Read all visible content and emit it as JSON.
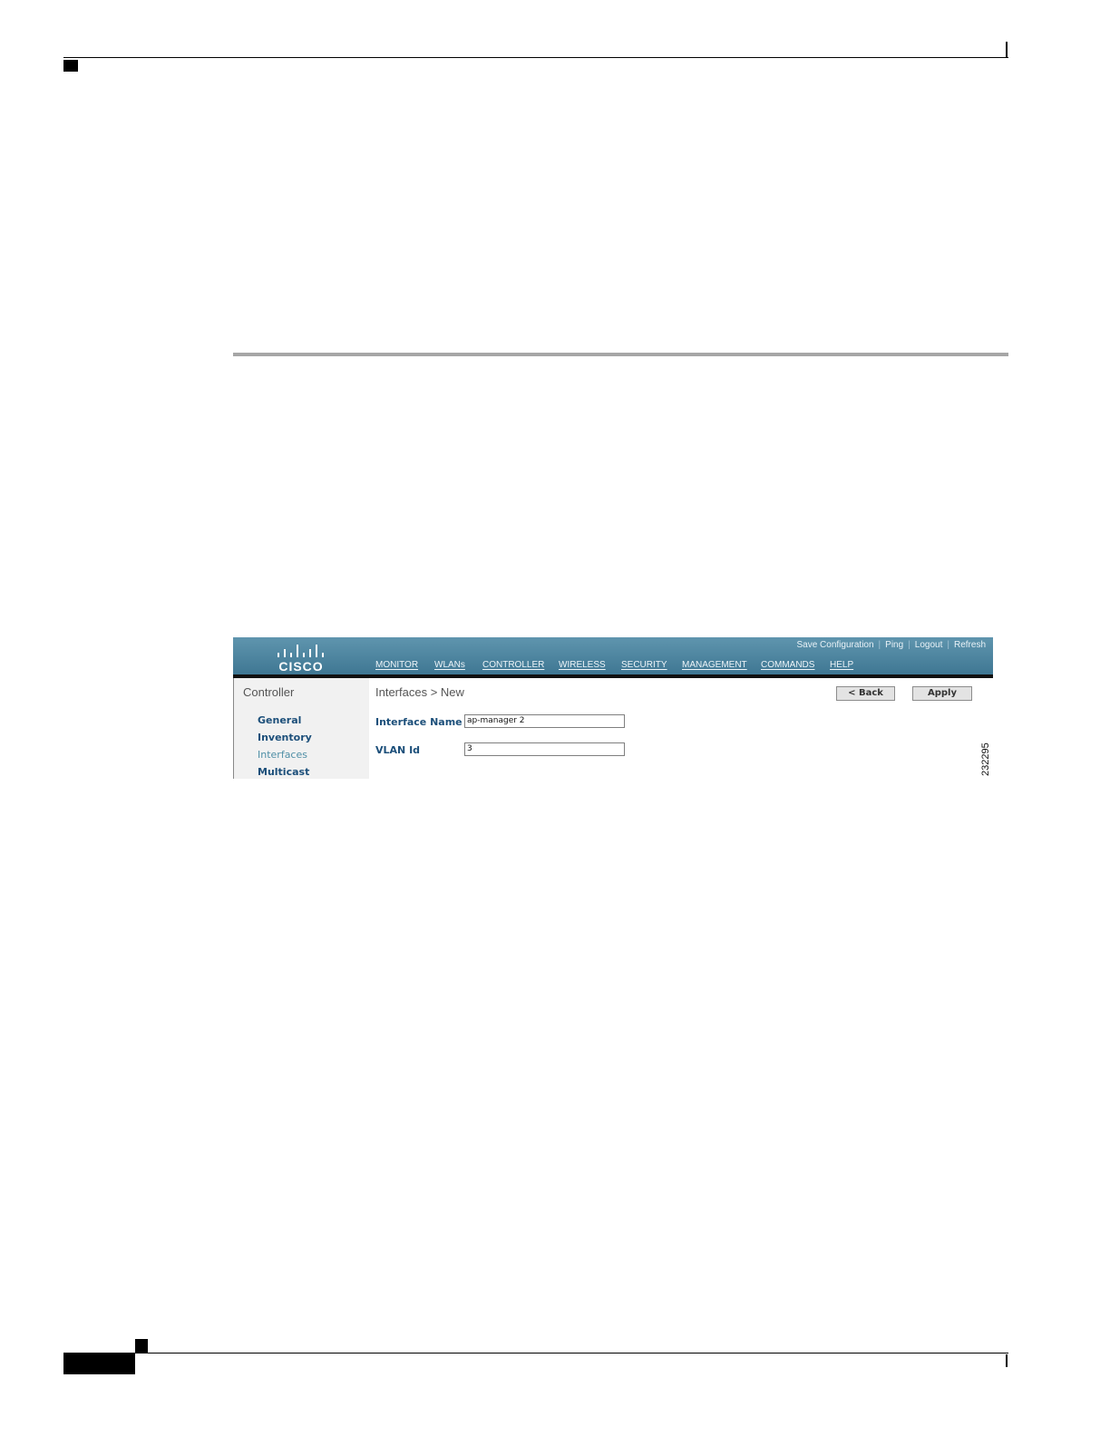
{
  "figure": {
    "number": "232295",
    "logo": {
      "text": "CISCO",
      "icon": "cisco-bridge-logo"
    },
    "utility_links": [
      "Save Configuration",
      "Ping",
      "Logout",
      "Refresh"
    ],
    "nav": [
      "MONITOR",
      "WLANs",
      "CONTROLLER",
      "WIRELESS",
      "SECURITY",
      "MANAGEMENT",
      "COMMANDS",
      "HELP"
    ],
    "nav_active": "CONTROLLER",
    "sidebar": {
      "title": "Controller",
      "items": [
        "General",
        "Inventory",
        "Interfaces",
        "Multicast"
      ],
      "selected": "Interfaces"
    },
    "breadcrumb": "Interfaces > New",
    "buttons": {
      "back": "< Back",
      "apply": "Apply"
    },
    "form": {
      "interface_name_label": "Interface Name",
      "interface_name_value": "ap-manager 2",
      "vlan_id_label": "VLAN Id",
      "vlan_id_value": "3"
    },
    "colors": {
      "header": "#4a84a0",
      "active_tab": "#e88d1e",
      "link": "#1c4f7a"
    }
  }
}
